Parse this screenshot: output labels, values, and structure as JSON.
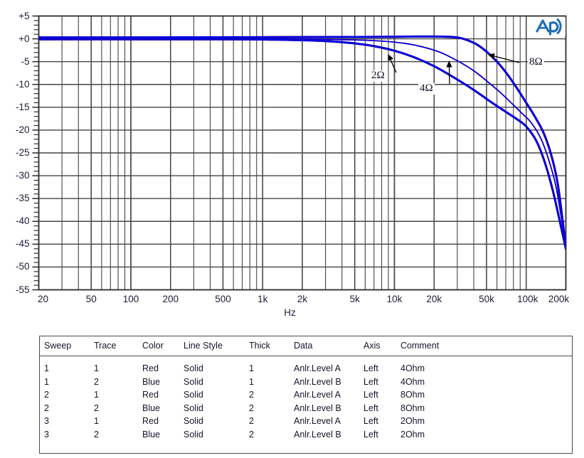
{
  "chart_data": {
    "type": "line",
    "title": "",
    "xlabel": "Hz",
    "ylabel": "",
    "xscale": "log",
    "xlim": [
      20,
      200000
    ],
    "ylim": [
      -55,
      5
    ],
    "grid": true,
    "legend_position": "below-chart-table",
    "xticks": [
      {
        "value": 20,
        "label": "20"
      },
      {
        "value": 50,
        "label": "50"
      },
      {
        "value": 100,
        "label": "100"
      },
      {
        "value": 200,
        "label": "200"
      },
      {
        "value": 500,
        "label": "500"
      },
      {
        "value": 1000,
        "label": "1k"
      },
      {
        "value": 2000,
        "label": "2k"
      },
      {
        "value": 5000,
        "label": "5k"
      },
      {
        "value": 10000,
        "label": "10k"
      },
      {
        "value": 20000,
        "label": "20k"
      },
      {
        "value": 50000,
        "label": "50k"
      },
      {
        "value": 100000,
        "label": "100k"
      },
      {
        "value": 200000,
        "label": "200k"
      }
    ],
    "yticks": [
      {
        "value": 5,
        "label": "+5"
      },
      {
        "value": 0,
        "label": "+0"
      },
      {
        "value": -5,
        "label": "-5"
      },
      {
        "value": -10,
        "label": "-10"
      },
      {
        "value": -15,
        "label": "-15"
      },
      {
        "value": -20,
        "label": "-20"
      },
      {
        "value": -25,
        "label": "-25"
      },
      {
        "value": -30,
        "label": "-30"
      },
      {
        "value": -35,
        "label": "-35"
      },
      {
        "value": -40,
        "label": "-40"
      },
      {
        "value": -45,
        "label": "-45"
      },
      {
        "value": -50,
        "label": "-50"
      },
      {
        "value": -55,
        "label": "-55"
      }
    ],
    "y_minor_tick_step": 1,
    "series": [
      {
        "name": "2Ohm Anlr.Level A",
        "color": "#ee0000",
        "width": 2,
        "x": [
          20,
          50,
          100,
          200,
          500,
          1000,
          2000,
          3000,
          5000,
          7000,
          10000,
          14000,
          20000,
          28000,
          40000,
          55000,
          70000,
          85000,
          100000,
          120000,
          140000,
          160000,
          180000,
          200000
        ],
        "y": [
          -0.1,
          -0.1,
          -0.1,
          -0.1,
          -0.1,
          -0.15,
          -0.3,
          -0.5,
          -1.0,
          -1.6,
          -2.6,
          -4.0,
          -6.0,
          -8.4,
          -11.2,
          -14.0,
          -16.0,
          -17.6,
          -19.2,
          -22.5,
          -27.5,
          -33.5,
          -40.0,
          -46.0
        ]
      },
      {
        "name": "2Ohm Anlr.Level B",
        "color": "#0000dd",
        "width": 2,
        "x": [
          20,
          50,
          100,
          200,
          500,
          1000,
          2000,
          3000,
          5000,
          7000,
          10000,
          14000,
          20000,
          28000,
          40000,
          55000,
          70000,
          85000,
          100000,
          120000,
          140000,
          160000,
          180000,
          200000
        ],
        "y": [
          -0.1,
          -0.1,
          -0.1,
          -0.1,
          -0.1,
          -0.15,
          -0.3,
          -0.5,
          -1.0,
          -1.6,
          -2.6,
          -4.0,
          -6.0,
          -8.4,
          -11.2,
          -14.0,
          -16.0,
          -17.6,
          -19.2,
          -22.5,
          -27.5,
          -33.5,
          -40.0,
          -46.0
        ]
      },
      {
        "name": "4Ohm Anlr.Level A",
        "color": "#ee0000",
        "width": 1,
        "x": [
          20,
          50,
          100,
          200,
          500,
          1000,
          2000,
          5000,
          8000,
          12000,
          16000,
          22000,
          30000,
          40000,
          52000,
          65000,
          80000,
          95000,
          110000,
          130000,
          150000,
          170000,
          200000
        ],
        "y": [
          0.0,
          0.0,
          0.0,
          0.0,
          0.0,
          0.0,
          -0.05,
          -0.25,
          -0.5,
          -1.0,
          -1.7,
          -2.9,
          -4.8,
          -7.0,
          -9.6,
          -12.0,
          -14.5,
          -16.6,
          -18.5,
          -22.0,
          -27.0,
          -33.0,
          -45.5
        ]
      },
      {
        "name": "4Ohm Anlr.Level B",
        "color": "#0000dd",
        "width": 1,
        "x": [
          20,
          50,
          100,
          200,
          500,
          1000,
          2000,
          5000,
          8000,
          12000,
          16000,
          22000,
          30000,
          40000,
          52000,
          65000,
          80000,
          95000,
          110000,
          130000,
          150000,
          170000,
          200000
        ],
        "y": [
          0.0,
          0.0,
          0.0,
          0.0,
          0.0,
          0.0,
          -0.05,
          -0.25,
          -0.5,
          -1.0,
          -1.7,
          -2.9,
          -4.8,
          -7.0,
          -9.6,
          -12.0,
          -14.5,
          -16.6,
          -18.5,
          -22.0,
          -27.0,
          -33.0,
          -45.5
        ]
      },
      {
        "name": "8Ohm Anlr.Level A",
        "color": "#ee0000",
        "width": 2,
        "x": [
          20,
          100,
          1000,
          5000,
          10000,
          15000,
          20000,
          25000,
          30000,
          35000,
          42000,
          50000,
          60000,
          72000,
          85000,
          100000,
          115000,
          135000,
          155000,
          175000,
          200000
        ],
        "y": [
          0.3,
          0.3,
          0.35,
          0.4,
          0.45,
          0.5,
          0.5,
          0.45,
          0.3,
          -0.2,
          -1.2,
          -2.8,
          -5.0,
          -7.8,
          -10.8,
          -14.0,
          -16.8,
          -20.5,
          -25.5,
          -32.5,
          -45.8
        ]
      },
      {
        "name": "8Ohm Anlr.Level B",
        "color": "#0000dd",
        "width": 2,
        "x": [
          20,
          100,
          1000,
          5000,
          10000,
          15000,
          20000,
          25000,
          30000,
          35000,
          42000,
          50000,
          60000,
          72000,
          85000,
          100000,
          115000,
          135000,
          155000,
          175000,
          200000
        ],
        "y": [
          0.3,
          0.3,
          0.35,
          0.4,
          0.45,
          0.5,
          0.5,
          0.45,
          0.3,
          -0.2,
          -1.2,
          -2.8,
          -5.0,
          -7.8,
          -10.8,
          -14.0,
          -16.8,
          -20.5,
          -25.5,
          -32.5,
          -45.8
        ]
      }
    ],
    "annotations": [
      {
        "text": "2Ω",
        "points_to_hz": 9000,
        "points_to_db": -3.5
      },
      {
        "text": "4Ω",
        "points_to_hz": 26000,
        "points_to_db": -5.0
      },
      {
        "text": "8Ω",
        "points_to_hz": 52000,
        "points_to_db": -3.5
      }
    ]
  },
  "logo": {
    "name": "audio-precision-logo",
    "text": "Ap",
    "color": "#1f6fb5"
  },
  "legend_table": {
    "headers": [
      "Sweep",
      "Trace",
      "Color",
      "Line Style",
      "Thick",
      "Data",
      "Axis",
      "Comment"
    ],
    "rows": [
      [
        "1",
        "1",
        "Red",
        "Solid",
        "1",
        "Anlr.Level A",
        "Left",
        "4Ohm"
      ],
      [
        "1",
        "2",
        "Blue",
        "Solid",
        "1",
        "Anlr.Level B",
        "Left",
        "4Ohm"
      ],
      [
        "2",
        "1",
        "Red",
        "Solid",
        "2",
        "Anlr.Level A",
        "Left",
        "8Ohm"
      ],
      [
        "2",
        "2",
        "Blue",
        "Solid",
        "2",
        "Anlr.Level B",
        "Left",
        "8Ohm"
      ],
      [
        "3",
        "1",
        "Red",
        "Solid",
        "2",
        "Anlr.Level A",
        "Left",
        "2Ohm"
      ],
      [
        "3",
        "2",
        "Blue",
        "Solid",
        "2",
        "Anlr.Level B",
        "Left",
        "2Ohm"
      ]
    ]
  },
  "colors": {
    "trace_red": "#ee0000",
    "trace_blue": "#0000dd",
    "grid": "#444444",
    "frame": "#333333",
    "logo_blue": "#1f6fb5"
  }
}
